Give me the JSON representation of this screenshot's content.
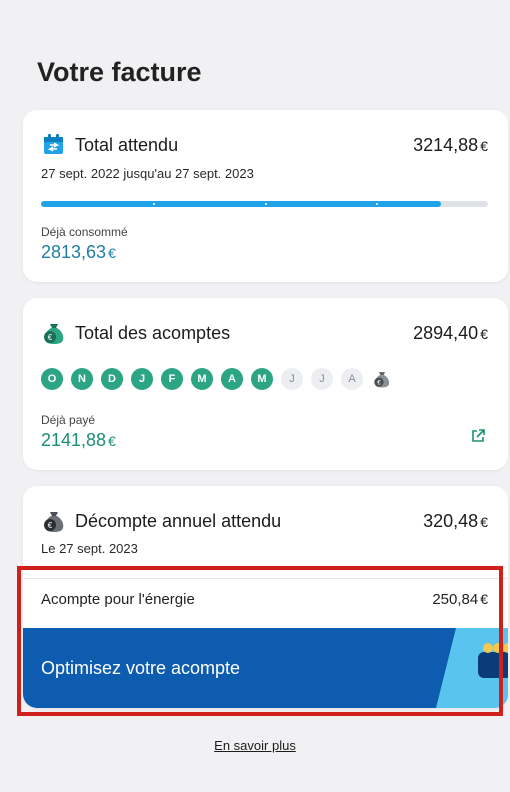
{
  "page": {
    "title": "Votre facture"
  },
  "total_card": {
    "title": "Total attendu",
    "amount": "3214,88",
    "currency": "€",
    "period": "27 sept. 2022 jusqu'au 27 sept. 2023",
    "progress_fraction": 0.895,
    "consumed_label": "Déjà consommé",
    "consumed_value": "2813,63",
    "icon": "calendar-icon",
    "accent_color": "#1fa3e6"
  },
  "deposits_card": {
    "title": "Total des acomptes",
    "amount": "2894,40",
    "currency": "€",
    "months": [
      {
        "letter": "O",
        "paid": true
      },
      {
        "letter": "N",
        "paid": true
      },
      {
        "letter": "D",
        "paid": true
      },
      {
        "letter": "J",
        "paid": true
      },
      {
        "letter": "F",
        "paid": true
      },
      {
        "letter": "M",
        "paid": true
      },
      {
        "letter": "A",
        "paid": true
      },
      {
        "letter": "M",
        "paid": true
      },
      {
        "letter": "J",
        "paid": false
      },
      {
        "letter": "J",
        "paid": false
      },
      {
        "letter": "A",
        "paid": false
      }
    ],
    "paid_label": "Déjà payé",
    "paid_value": "2141,88",
    "icon": "money-bag-icon",
    "paid_color": "#2ba583"
  },
  "annual_card": {
    "title": "Décompte annuel attendu",
    "amount": "320,48",
    "currency": "€",
    "date": "Le 27 sept. 2023",
    "energy_label": "Acompte pour l'énergie",
    "energy_amount": "250,84",
    "banner_text": "Optimisez votre acompte",
    "banner_color": "#0d5cb0",
    "icon": "money-bag-icon"
  },
  "footer": {
    "learn_more": "En savoir plus"
  }
}
